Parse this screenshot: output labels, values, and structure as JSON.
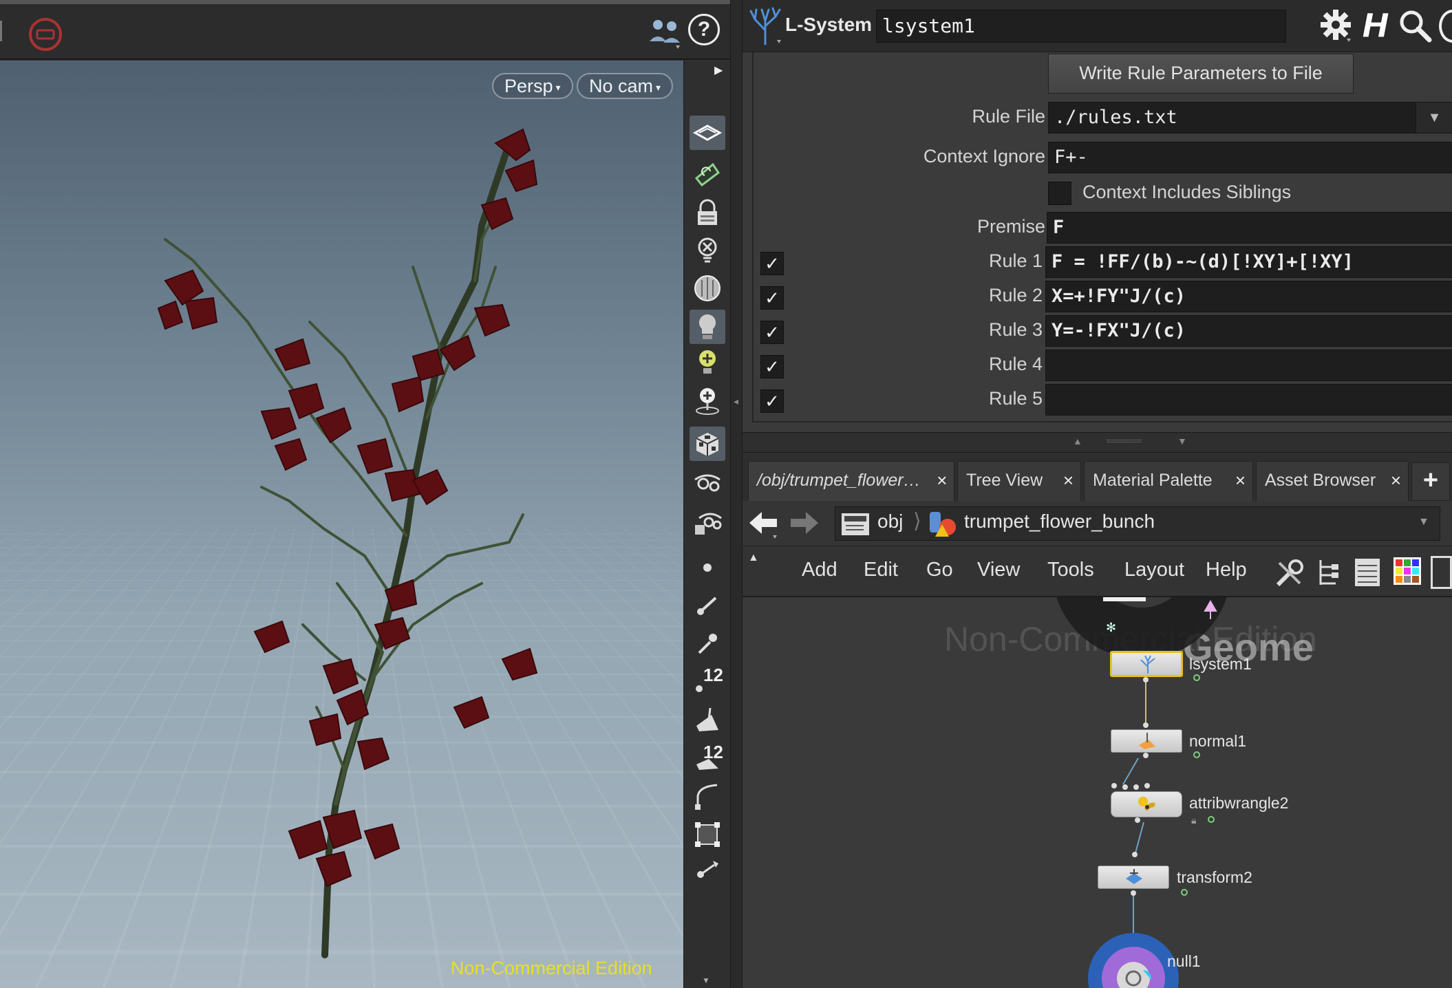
{
  "viewport": {
    "camera_persp": "Persp",
    "camera_cam": "No cam",
    "watermark": "Non-Commercial Edition",
    "side_tools": [
      "display-options-icon",
      "snap-icon",
      "lock-camera-icon",
      "ghost-icon",
      "shading-icon",
      "light-bulb-icon",
      "add-light-icon",
      "add-spotlight-icon",
      "checker-cube-icon",
      "view-icon",
      "camera-view-icon",
      "point-icon",
      "line-icon",
      "dropper-icon",
      "number-12-icon",
      "prim-icon",
      "number-12-prim-icon",
      "curve-icon",
      "transform-handles-icon",
      "brush-icon"
    ],
    "side_numbers": {
      "a": "12",
      "b": "12"
    }
  },
  "params": {
    "node_type": "L-System",
    "node_name": "lsystem1",
    "write_button": "Write Rule Parameters to File",
    "rule_file_label": "Rule File",
    "rule_file_value": "./rules.txt",
    "context_ignore_label": "Context Ignore",
    "context_ignore_value": "F+-",
    "context_siblings_label": "Context Includes Siblings",
    "premise_label": "Premise",
    "premise_value": "F",
    "rules": [
      {
        "label": "Rule 1",
        "value": "F = !FF/(b)-~(d)[!XY]+[!XY]",
        "enabled": true
      },
      {
        "label": "Rule 2",
        "value": "X=+!FY\"J/(c)",
        "enabled": true
      },
      {
        "label": "Rule 3",
        "value": "Y=-!FX\"J/(c)",
        "enabled": true
      },
      {
        "label": "Rule 4",
        "value": "",
        "enabled": true
      },
      {
        "label": "Rule 5",
        "value": "",
        "enabled": true
      }
    ],
    "check_glyph": "✓"
  },
  "network": {
    "tabs": [
      {
        "label": "/obj/trumpet_flower…"
      },
      {
        "label": "Tree View"
      },
      {
        "label": "Material Palette"
      },
      {
        "label": "Asset Browser"
      }
    ],
    "tab_close": "×",
    "tab_add": "+",
    "path_root": "obj",
    "path_node": "trumpet_flower_bunch",
    "menu": [
      "Add",
      "Edit",
      "Go",
      "View",
      "Tools",
      "Layout",
      "Help"
    ],
    "watermark": "Non-Commercial Edition",
    "context_label": "Geome",
    "nodes": [
      "lsystem1",
      "normal1",
      "attribwrangle2",
      "transform2",
      "null1"
    ]
  }
}
